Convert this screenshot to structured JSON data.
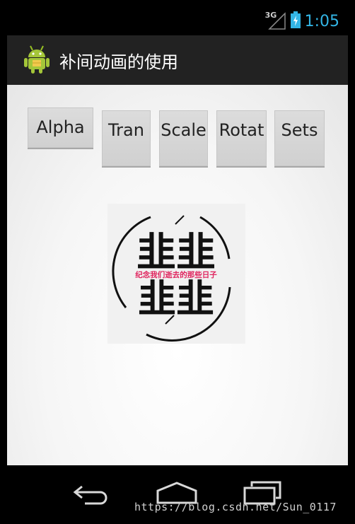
{
  "status_bar": {
    "network_label": "3G",
    "time": "1:05",
    "icons": [
      "signal-icon",
      "battery-icon"
    ],
    "accent_color": "#33b5e5"
  },
  "action_bar": {
    "title": "补间动画的使用",
    "icon": "android-robot-icon"
  },
  "buttons": [
    {
      "id": "alpha",
      "label": "Alpha"
    },
    {
      "id": "tran",
      "label": "Tran"
    },
    {
      "id": "scale",
      "label": "Scale"
    },
    {
      "id": "rotat",
      "label": "Rotat"
    },
    {
      "id": "sets",
      "label": "Sets"
    }
  ],
  "image": {
    "top_text": "韭韭",
    "middle_text": "纪念我们逝去的那些日子",
    "bottom_text": "韭韭",
    "accent_color": "#e0245e"
  },
  "nav_bar": {
    "icons": [
      "back-icon",
      "home-icon",
      "recent-apps-icon"
    ]
  },
  "watermark": "https://blog.csdn.net/Sun_0117"
}
